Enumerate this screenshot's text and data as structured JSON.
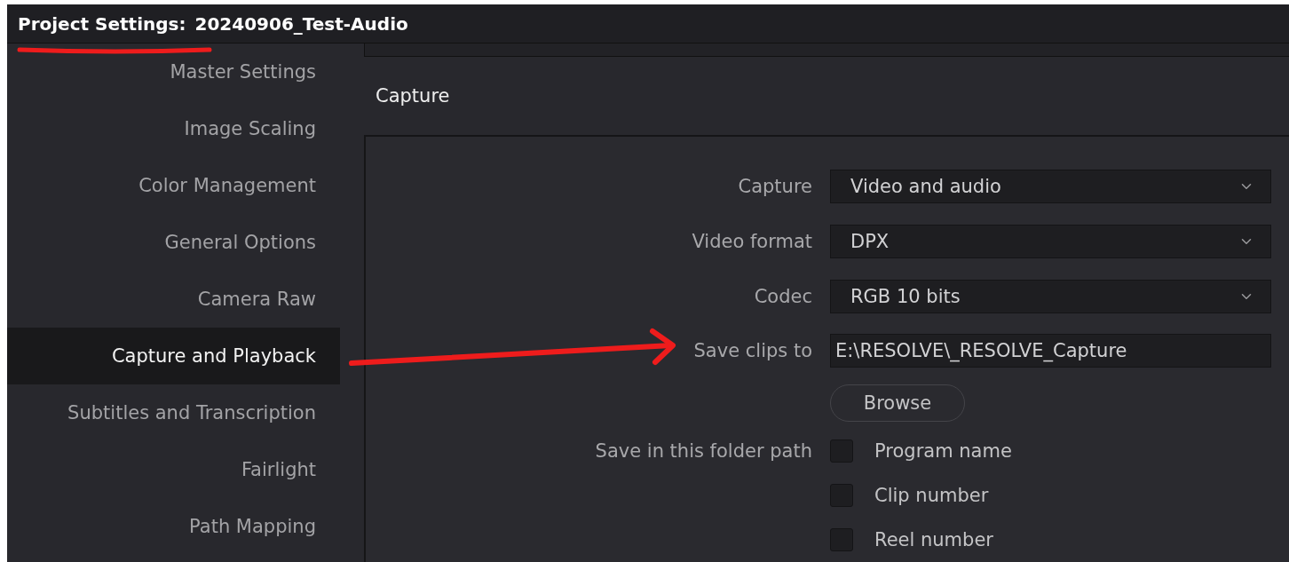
{
  "title_bar": {
    "label": "Project Settings:",
    "project": "20240906_Test-Audio"
  },
  "sidebar": {
    "items": [
      {
        "label": "Master Settings",
        "selected": false
      },
      {
        "label": "Image Scaling",
        "selected": false
      },
      {
        "label": "Color Management",
        "selected": false
      },
      {
        "label": "General Options",
        "selected": false
      },
      {
        "label": "Camera Raw",
        "selected": false
      },
      {
        "label": "Capture and Playback",
        "selected": true
      },
      {
        "label": "Subtitles and Transcription",
        "selected": false
      },
      {
        "label": "Fairlight",
        "selected": false
      },
      {
        "label": "Path Mapping",
        "selected": false
      }
    ]
  },
  "section": {
    "title": "Capture",
    "rows": [
      {
        "kind": "dropdown",
        "label": "Capture",
        "value": "Video and audio"
      },
      {
        "kind": "dropdown",
        "label": "Video format",
        "value": "DPX"
      },
      {
        "kind": "dropdown",
        "label": "Codec",
        "value": "RGB 10 bits"
      },
      {
        "kind": "text",
        "label": "Save clips to",
        "value": "E:\\RESOLVE\\_RESOLVE_Capture"
      },
      {
        "kind": "button",
        "value": "Browse"
      },
      {
        "kind": "checkbox",
        "label": "Save in this folder path",
        "value": "Program name",
        "checked": false
      },
      {
        "kind": "checkbox",
        "value": "Clip number",
        "checked": false
      },
      {
        "kind": "checkbox",
        "value": "Reel number",
        "checked": false
      }
    ]
  }
}
